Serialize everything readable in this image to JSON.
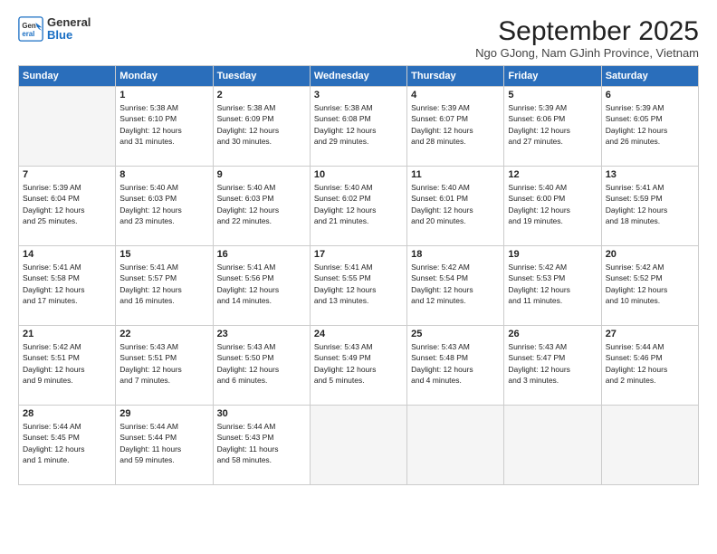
{
  "logo": {
    "general": "General",
    "blue": "Blue"
  },
  "title": "September 2025",
  "location": "Ngo GJong, Nam GJinh Province, Vietnam",
  "headers": [
    "Sunday",
    "Monday",
    "Tuesday",
    "Wednesday",
    "Thursday",
    "Friday",
    "Saturday"
  ],
  "weeks": [
    [
      {
        "day": "",
        "info": ""
      },
      {
        "day": "1",
        "info": "Sunrise: 5:38 AM\nSunset: 6:10 PM\nDaylight: 12 hours\nand 31 minutes."
      },
      {
        "day": "2",
        "info": "Sunrise: 5:38 AM\nSunset: 6:09 PM\nDaylight: 12 hours\nand 30 minutes."
      },
      {
        "day": "3",
        "info": "Sunrise: 5:38 AM\nSunset: 6:08 PM\nDaylight: 12 hours\nand 29 minutes."
      },
      {
        "day": "4",
        "info": "Sunrise: 5:39 AM\nSunset: 6:07 PM\nDaylight: 12 hours\nand 28 minutes."
      },
      {
        "day": "5",
        "info": "Sunrise: 5:39 AM\nSunset: 6:06 PM\nDaylight: 12 hours\nand 27 minutes."
      },
      {
        "day": "6",
        "info": "Sunrise: 5:39 AM\nSunset: 6:05 PM\nDaylight: 12 hours\nand 26 minutes."
      }
    ],
    [
      {
        "day": "7",
        "info": "Sunrise: 5:39 AM\nSunset: 6:04 PM\nDaylight: 12 hours\nand 25 minutes."
      },
      {
        "day": "8",
        "info": "Sunrise: 5:40 AM\nSunset: 6:03 PM\nDaylight: 12 hours\nand 23 minutes."
      },
      {
        "day": "9",
        "info": "Sunrise: 5:40 AM\nSunset: 6:03 PM\nDaylight: 12 hours\nand 22 minutes."
      },
      {
        "day": "10",
        "info": "Sunrise: 5:40 AM\nSunset: 6:02 PM\nDaylight: 12 hours\nand 21 minutes."
      },
      {
        "day": "11",
        "info": "Sunrise: 5:40 AM\nSunset: 6:01 PM\nDaylight: 12 hours\nand 20 minutes."
      },
      {
        "day": "12",
        "info": "Sunrise: 5:40 AM\nSunset: 6:00 PM\nDaylight: 12 hours\nand 19 minutes."
      },
      {
        "day": "13",
        "info": "Sunrise: 5:41 AM\nSunset: 5:59 PM\nDaylight: 12 hours\nand 18 minutes."
      }
    ],
    [
      {
        "day": "14",
        "info": "Sunrise: 5:41 AM\nSunset: 5:58 PM\nDaylight: 12 hours\nand 17 minutes."
      },
      {
        "day": "15",
        "info": "Sunrise: 5:41 AM\nSunset: 5:57 PM\nDaylight: 12 hours\nand 16 minutes."
      },
      {
        "day": "16",
        "info": "Sunrise: 5:41 AM\nSunset: 5:56 PM\nDaylight: 12 hours\nand 14 minutes."
      },
      {
        "day": "17",
        "info": "Sunrise: 5:41 AM\nSunset: 5:55 PM\nDaylight: 12 hours\nand 13 minutes."
      },
      {
        "day": "18",
        "info": "Sunrise: 5:42 AM\nSunset: 5:54 PM\nDaylight: 12 hours\nand 12 minutes."
      },
      {
        "day": "19",
        "info": "Sunrise: 5:42 AM\nSunset: 5:53 PM\nDaylight: 12 hours\nand 11 minutes."
      },
      {
        "day": "20",
        "info": "Sunrise: 5:42 AM\nSunset: 5:52 PM\nDaylight: 12 hours\nand 10 minutes."
      }
    ],
    [
      {
        "day": "21",
        "info": "Sunrise: 5:42 AM\nSunset: 5:51 PM\nDaylight: 12 hours\nand 9 minutes."
      },
      {
        "day": "22",
        "info": "Sunrise: 5:43 AM\nSunset: 5:51 PM\nDaylight: 12 hours\nand 7 minutes."
      },
      {
        "day": "23",
        "info": "Sunrise: 5:43 AM\nSunset: 5:50 PM\nDaylight: 12 hours\nand 6 minutes."
      },
      {
        "day": "24",
        "info": "Sunrise: 5:43 AM\nSunset: 5:49 PM\nDaylight: 12 hours\nand 5 minutes."
      },
      {
        "day": "25",
        "info": "Sunrise: 5:43 AM\nSunset: 5:48 PM\nDaylight: 12 hours\nand 4 minutes."
      },
      {
        "day": "26",
        "info": "Sunrise: 5:43 AM\nSunset: 5:47 PM\nDaylight: 12 hours\nand 3 minutes."
      },
      {
        "day": "27",
        "info": "Sunrise: 5:44 AM\nSunset: 5:46 PM\nDaylight: 12 hours\nand 2 minutes."
      }
    ],
    [
      {
        "day": "28",
        "info": "Sunrise: 5:44 AM\nSunset: 5:45 PM\nDaylight: 12 hours\nand 1 minute."
      },
      {
        "day": "29",
        "info": "Sunrise: 5:44 AM\nSunset: 5:44 PM\nDaylight: 11 hours\nand 59 minutes."
      },
      {
        "day": "30",
        "info": "Sunrise: 5:44 AM\nSunset: 5:43 PM\nDaylight: 11 hours\nand 58 minutes."
      },
      {
        "day": "",
        "info": ""
      },
      {
        "day": "",
        "info": ""
      },
      {
        "day": "",
        "info": ""
      },
      {
        "day": "",
        "info": ""
      }
    ]
  ]
}
